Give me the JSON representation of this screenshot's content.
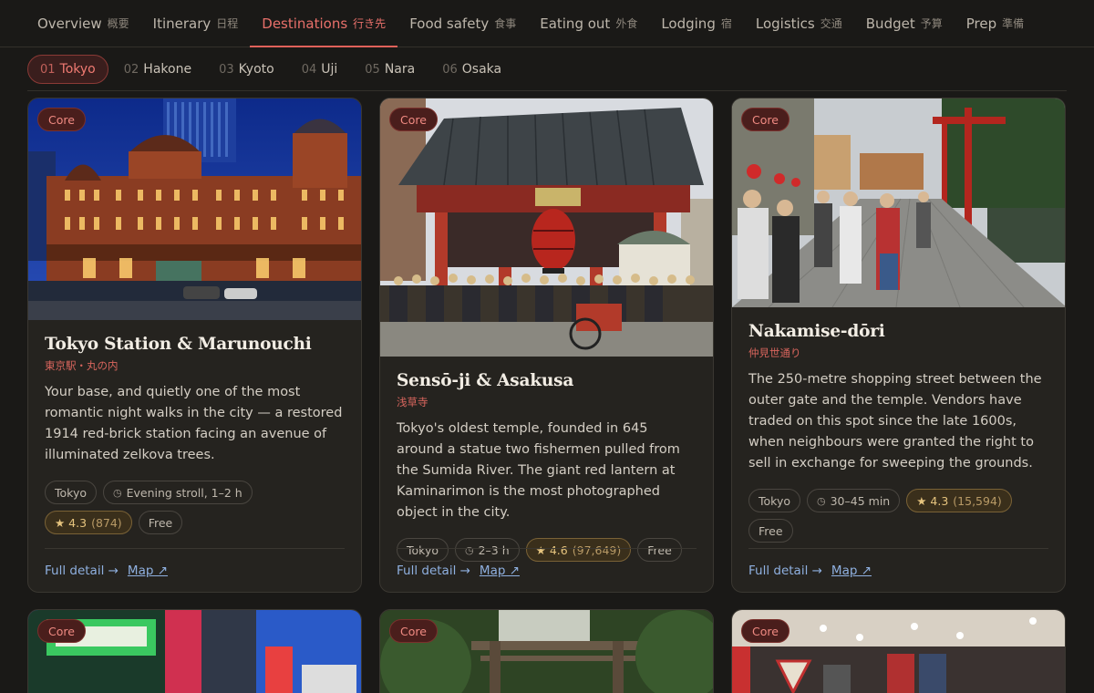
{
  "topnav": [
    {
      "label": "Overview",
      "jp": "概要",
      "active": false
    },
    {
      "label": "Itinerary",
      "jp": "日程",
      "active": false
    },
    {
      "label": "Destinations",
      "jp": "行き先",
      "active": true
    },
    {
      "label": "Food safety",
      "jp": "食事",
      "active": false
    },
    {
      "label": "Eating out",
      "jp": "外食",
      "active": false
    },
    {
      "label": "Lodging",
      "jp": "宿",
      "active": false
    },
    {
      "label": "Logistics",
      "jp": "交通",
      "active": false
    },
    {
      "label": "Budget",
      "jp": "予算",
      "active": false
    },
    {
      "label": "Prep",
      "jp": "準備",
      "active": false
    }
  ],
  "subnav": [
    {
      "num": "01",
      "label": "Tokyo",
      "active": true
    },
    {
      "num": "02",
      "label": "Hakone",
      "active": false
    },
    {
      "num": "03",
      "label": "Kyoto",
      "active": false
    },
    {
      "num": "04",
      "label": "Uji",
      "active": false
    },
    {
      "num": "05",
      "label": "Nara",
      "active": false
    },
    {
      "num": "06",
      "label": "Osaka",
      "active": false
    }
  ],
  "cards": [
    {
      "badge": "Core",
      "title": "Tokyo Station & Marunouchi",
      "jp": "東京駅・丸の内",
      "desc": "Your base, and quietly one of the most romantic night walks in the city — a restored 1914 red-brick station facing an avenue of illuminated zelkova trees.",
      "chips": {
        "area": "Tokyo",
        "time": "Evening stroll, 1–2 h",
        "rating": "★ 4.3",
        "count": "(874)",
        "price": "Free"
      },
      "detail": "Full detail →",
      "map": "Map ↗"
    },
    {
      "badge": "Core",
      "title": "Sensō-ji & Asakusa",
      "jp": "浅草寺",
      "desc": "Tokyo's oldest temple, founded in 645 around a statue two fishermen pulled from the Sumida River. The giant red lantern at Kaminarimon is the most photographed object in the city.",
      "chips": {
        "area": "Tokyo",
        "time": "2–3 h",
        "rating": "★ 4.6",
        "count": "(97,649)",
        "price": "Free"
      },
      "detail": "Full detail →",
      "map": "Map ↗"
    },
    {
      "badge": "Core",
      "title": "Nakamise-dōri",
      "jp": "仲見世通り",
      "desc": "The 250-metre shopping street between the outer gate and the temple. Vendors have traded on this spot since the late 1600s, when neighbours were granted the right to sell in exchange for sweeping the grounds.",
      "chips": {
        "area": "Tokyo",
        "time": "30–45 min",
        "rating": "★ 4.3",
        "count": "(15,594)",
        "price": "Free"
      },
      "detail": "Full detail →",
      "map": "Map ↗"
    },
    {
      "badge": "Core"
    },
    {
      "badge": "Core"
    },
    {
      "badge": "Core"
    }
  ],
  "colors": {
    "accent": "#e0615a",
    "link": "#8fb0e0",
    "rating": "#e6c47e",
    "background": "#1a1917"
  }
}
